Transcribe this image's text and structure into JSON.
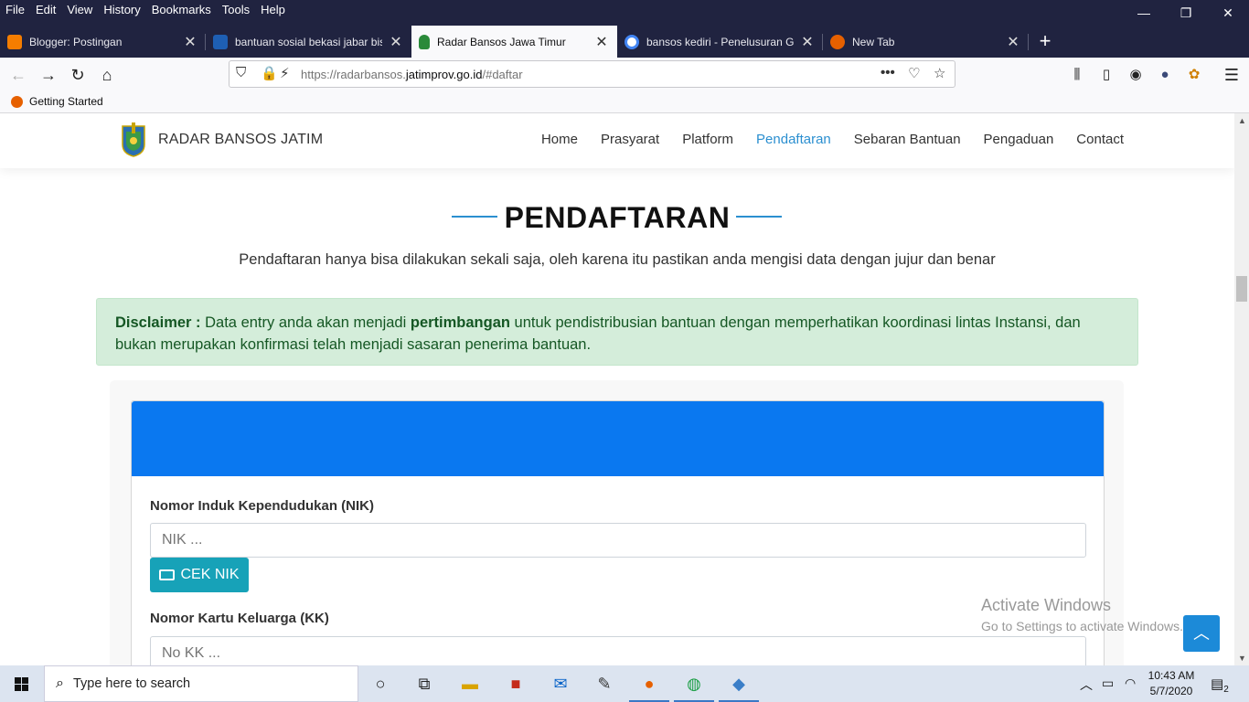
{
  "menu": [
    "File",
    "Edit",
    "View",
    "History",
    "Bookmarks",
    "Tools",
    "Help"
  ],
  "window_controls": {
    "minimize": "—",
    "restore": "❐",
    "close": "✕"
  },
  "tabs": [
    {
      "title": "Blogger: Postingan",
      "favicon_color": "#f57d00",
      "active": false
    },
    {
      "title": "bantuan sosial bekasi jabar bisa",
      "favicon_color": "#1e5fb4",
      "active": false
    },
    {
      "title": "Radar Bansos Jawa Timur",
      "favicon_color": "#2a8a3a",
      "active": true
    },
    {
      "title": "bansos kediri - Penelusuran Go",
      "favicon_color": "#4285f4",
      "active": false
    },
    {
      "title": "New Tab",
      "favicon_color": "#e66000",
      "active": false
    }
  ],
  "new_tab_label": "+",
  "url": {
    "prefix": "https://radarbansos.",
    "domain": "jatimprov.go.id",
    "suffix": "/#daftar"
  },
  "bookmarks": [
    "Getting Started"
  ],
  "site": {
    "name": "RADAR BANSOS JATIM",
    "nav": [
      {
        "label": "Home",
        "active": false
      },
      {
        "label": "Prasyarat",
        "active": false
      },
      {
        "label": "Platform",
        "active": false
      },
      {
        "label": "Pendaftaran",
        "active": true
      },
      {
        "label": "Sebaran Bantuan",
        "active": false
      },
      {
        "label": "Pengaduan",
        "active": false
      },
      {
        "label": "Contact",
        "active": false
      }
    ],
    "accent": "#2b8fd0"
  },
  "section": {
    "title": "PENDAFTARAN",
    "subtitle": "Pendaftaran hanya bisa dilakukan sekali saja, oleh karena itu pastikan anda mengisi data dengan jujur dan benar"
  },
  "disclaimer": {
    "label": "Disclaimer :",
    "text1": " Data entry anda akan menjadi ",
    "bold": "pertimbangan",
    "text2": " untuk pendistribusian bantuan dengan memperhatikan koordinasi lintas Instansi, dan bukan merupakan konfirmasi telah menjadi sasaran penerima bantuan."
  },
  "form": {
    "header_color": "#0a78f0",
    "nik_label": "Nomor Induk Kependudukan (NIK)",
    "nik_placeholder": "NIK ...",
    "cek_button": "CEK NIK",
    "kk_label": "Nomor Kartu Keluarga (KK)",
    "kk_placeholder": "No KK ..."
  },
  "activate_windows": {
    "line1": "Activate Windows",
    "line2": "Go to Settings to activate Windows."
  },
  "taskbar": {
    "search_placeholder": "Type here to search",
    "time": "10:43 AM",
    "date": "5/7/2020",
    "notifications": "2"
  }
}
